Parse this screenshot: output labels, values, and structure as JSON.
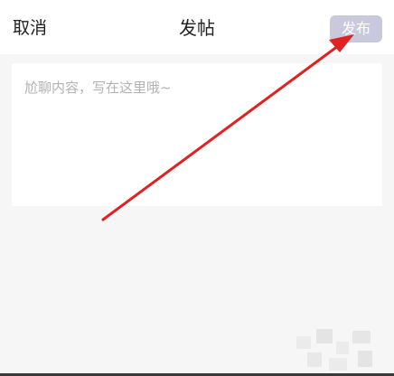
{
  "header": {
    "cancel_label": "取消",
    "title": "发帖",
    "publish_label": "发布"
  },
  "editor": {
    "placeholder": "尬聊内容，写在这里哦~",
    "value": ""
  },
  "colors": {
    "background": "#f6f6f6",
    "publish_button_bg": "#c9c9dd",
    "annotation_arrow": "#e02222"
  }
}
